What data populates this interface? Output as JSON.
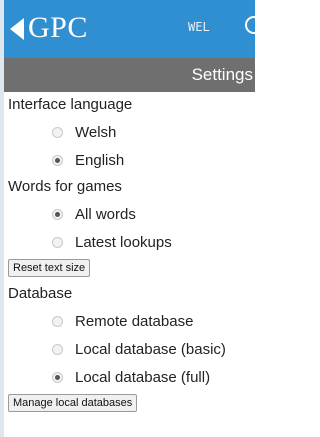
{
  "header": {
    "title": "GPC",
    "language_button": "WEL",
    "back_icon": "back-triangle-icon",
    "menu_icon": "menu-icon",
    "background": "#2f8fd0"
  },
  "settings_bar": {
    "title": "Settings",
    "background": "#6f6f6f"
  },
  "interface_language": {
    "label": "Interface language",
    "options": [
      {
        "label": "Welsh",
        "checked": false
      },
      {
        "label": "English",
        "checked": true
      }
    ]
  },
  "words_for_games": {
    "label": "Words for games",
    "options": [
      {
        "label": "All words",
        "checked": true
      },
      {
        "label": "Latest lookups",
        "checked": false
      }
    ]
  },
  "reset_text_size_button": "Reset text size",
  "database": {
    "label": "Database",
    "options": [
      {
        "label": "Remote database",
        "checked": false
      },
      {
        "label": "Local database (basic)",
        "checked": false
      },
      {
        "label": "Local database (full)",
        "checked": true
      }
    ]
  },
  "manage_local_databases_button": "Manage local databases"
}
